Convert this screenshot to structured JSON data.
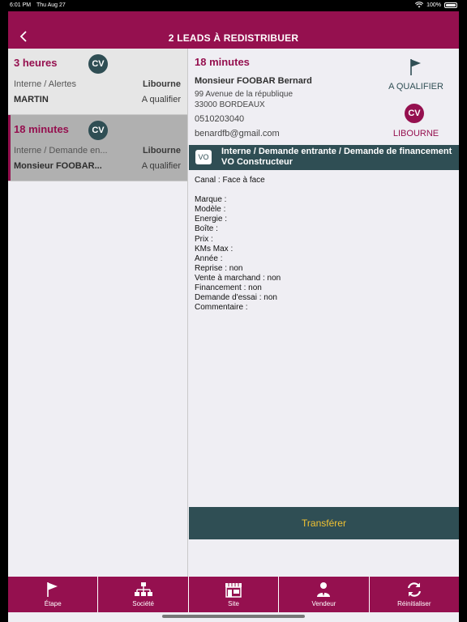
{
  "status_bar": {
    "time": "6:01 PM",
    "date": "Thu Aug 27",
    "battery": "100%"
  },
  "header": {
    "title": "2 LEADS À REDISTRIBUER"
  },
  "leads": [
    {
      "duration": "3 heures",
      "badge": "CV",
      "source": "Interne / Alertes",
      "city": "Libourne",
      "name": "MARTIN",
      "status": "A qualifier"
    },
    {
      "duration": "18 minutes",
      "badge": "CV",
      "source": "Interne / Demande en...",
      "city": "Libourne",
      "name": "Monsieur FOOBAR...",
      "status": "A qualifier"
    }
  ],
  "detail": {
    "duration": "18 minutes",
    "client_name": "Monsieur FOOBAR Bernard",
    "address_line1": "99 Avenue de la république",
    "address_line2": "33000 BORDEAUX",
    "phone": "0510203040",
    "email": "benardfb@gmail.com",
    "status_label": "A QUALIFIER",
    "badge": "CV",
    "agency": "LIBOURNE",
    "request_tag": "VO",
    "request_title": "Interne / Demande entrante / Demande de financement VO Constructeur",
    "body_lines": [
      "Canal : Face à face",
      "",
      "Marque :",
      "Modèle :",
      "Energie :",
      "Boîte :",
      "Prix :",
      "KMs Max :",
      "Année :",
      "Reprise : non",
      "Vente à marchand : non",
      "Financement : non",
      "Demande d'essai : non",
      "Commentaire :"
    ],
    "transfer_label": "Transférer"
  },
  "tabs": [
    {
      "label": "Étape",
      "icon": "flag-icon"
    },
    {
      "label": "Société",
      "icon": "org-chart-icon"
    },
    {
      "label": "Site",
      "icon": "store-icon"
    },
    {
      "label": "Vendeur",
      "icon": "person-icon"
    },
    {
      "label": "Réinitialiser",
      "icon": "refresh-icon"
    }
  ],
  "colors": {
    "brand": "#95104f",
    "dark_teal": "#2f4e54",
    "accent_yellow": "#f1c232"
  }
}
